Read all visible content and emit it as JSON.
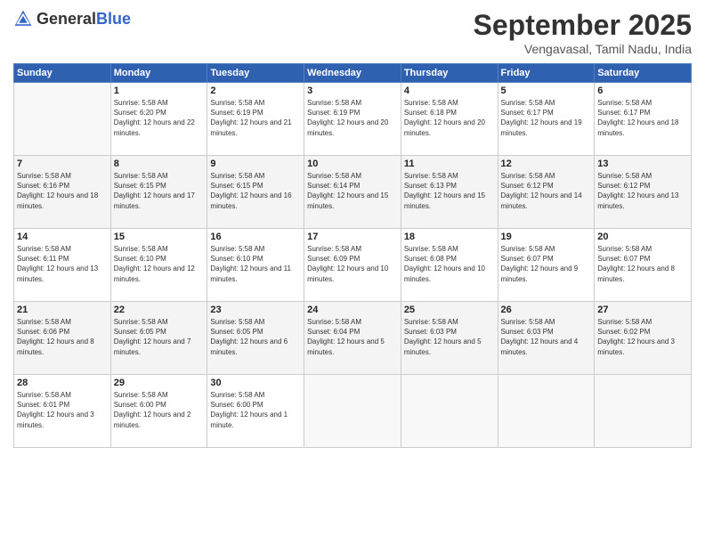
{
  "header": {
    "logo_general": "General",
    "logo_blue": "Blue",
    "month_title": "September 2025",
    "subtitle": "Vengavasal, Tamil Nadu, India"
  },
  "days_of_week": [
    "Sunday",
    "Monday",
    "Tuesday",
    "Wednesday",
    "Thursday",
    "Friday",
    "Saturday"
  ],
  "weeks": [
    [
      {
        "day": "",
        "empty": true
      },
      {
        "day": "1",
        "sunrise": "5:58 AM",
        "sunset": "6:20 PM",
        "daylight": "12 hours and 22 minutes."
      },
      {
        "day": "2",
        "sunrise": "5:58 AM",
        "sunset": "6:19 PM",
        "daylight": "12 hours and 21 minutes."
      },
      {
        "day": "3",
        "sunrise": "5:58 AM",
        "sunset": "6:19 PM",
        "daylight": "12 hours and 20 minutes."
      },
      {
        "day": "4",
        "sunrise": "5:58 AM",
        "sunset": "6:18 PM",
        "daylight": "12 hours and 20 minutes."
      },
      {
        "day": "5",
        "sunrise": "5:58 AM",
        "sunset": "6:17 PM",
        "daylight": "12 hours and 19 minutes."
      },
      {
        "day": "6",
        "sunrise": "5:58 AM",
        "sunset": "6:17 PM",
        "daylight": "12 hours and 18 minutes."
      }
    ],
    [
      {
        "day": "7",
        "sunrise": "5:58 AM",
        "sunset": "6:16 PM",
        "daylight": "12 hours and 18 minutes."
      },
      {
        "day": "8",
        "sunrise": "5:58 AM",
        "sunset": "6:15 PM",
        "daylight": "12 hours and 17 minutes."
      },
      {
        "day": "9",
        "sunrise": "5:58 AM",
        "sunset": "6:15 PM",
        "daylight": "12 hours and 16 minutes."
      },
      {
        "day": "10",
        "sunrise": "5:58 AM",
        "sunset": "6:14 PM",
        "daylight": "12 hours and 15 minutes."
      },
      {
        "day": "11",
        "sunrise": "5:58 AM",
        "sunset": "6:13 PM",
        "daylight": "12 hours and 15 minutes."
      },
      {
        "day": "12",
        "sunrise": "5:58 AM",
        "sunset": "6:12 PM",
        "daylight": "12 hours and 14 minutes."
      },
      {
        "day": "13",
        "sunrise": "5:58 AM",
        "sunset": "6:12 PM",
        "daylight": "12 hours and 13 minutes."
      }
    ],
    [
      {
        "day": "14",
        "sunrise": "5:58 AM",
        "sunset": "6:11 PM",
        "daylight": "12 hours and 13 minutes."
      },
      {
        "day": "15",
        "sunrise": "5:58 AM",
        "sunset": "6:10 PM",
        "daylight": "12 hours and 12 minutes."
      },
      {
        "day": "16",
        "sunrise": "5:58 AM",
        "sunset": "6:10 PM",
        "daylight": "12 hours and 11 minutes."
      },
      {
        "day": "17",
        "sunrise": "5:58 AM",
        "sunset": "6:09 PM",
        "daylight": "12 hours and 10 minutes."
      },
      {
        "day": "18",
        "sunrise": "5:58 AM",
        "sunset": "6:08 PM",
        "daylight": "12 hours and 10 minutes."
      },
      {
        "day": "19",
        "sunrise": "5:58 AM",
        "sunset": "6:07 PM",
        "daylight": "12 hours and 9 minutes."
      },
      {
        "day": "20",
        "sunrise": "5:58 AM",
        "sunset": "6:07 PM",
        "daylight": "12 hours and 8 minutes."
      }
    ],
    [
      {
        "day": "21",
        "sunrise": "5:58 AM",
        "sunset": "6:06 PM",
        "daylight": "12 hours and 8 minutes."
      },
      {
        "day": "22",
        "sunrise": "5:58 AM",
        "sunset": "6:05 PM",
        "daylight": "12 hours and 7 minutes."
      },
      {
        "day": "23",
        "sunrise": "5:58 AM",
        "sunset": "6:05 PM",
        "daylight": "12 hours and 6 minutes."
      },
      {
        "day": "24",
        "sunrise": "5:58 AM",
        "sunset": "6:04 PM",
        "daylight": "12 hours and 5 minutes."
      },
      {
        "day": "25",
        "sunrise": "5:58 AM",
        "sunset": "6:03 PM",
        "daylight": "12 hours and 5 minutes."
      },
      {
        "day": "26",
        "sunrise": "5:58 AM",
        "sunset": "6:03 PM",
        "daylight": "12 hours and 4 minutes."
      },
      {
        "day": "27",
        "sunrise": "5:58 AM",
        "sunset": "6:02 PM",
        "daylight": "12 hours and 3 minutes."
      }
    ],
    [
      {
        "day": "28",
        "sunrise": "5:58 AM",
        "sunset": "6:01 PM",
        "daylight": "12 hours and 3 minutes."
      },
      {
        "day": "29",
        "sunrise": "5:58 AM",
        "sunset": "6:00 PM",
        "daylight": "12 hours and 2 minutes."
      },
      {
        "day": "30",
        "sunrise": "5:58 AM",
        "sunset": "6:00 PM",
        "daylight": "12 hours and 1 minute."
      },
      {
        "day": "",
        "empty": true
      },
      {
        "day": "",
        "empty": true
      },
      {
        "day": "",
        "empty": true
      },
      {
        "day": "",
        "empty": true
      }
    ]
  ],
  "labels": {
    "sunrise_prefix": "Sunrise: ",
    "sunset_prefix": "Sunset: ",
    "daylight_prefix": "Daylight: "
  }
}
